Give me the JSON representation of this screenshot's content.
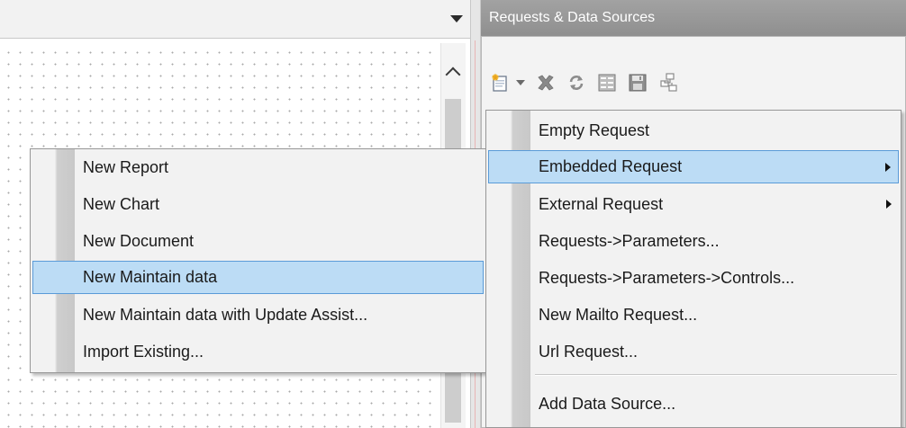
{
  "right_panel": {
    "title": "Requests & Data Sources",
    "toolbar": {
      "buttons": [
        {
          "icon": "new-request-icon"
        },
        {
          "icon": "delete-icon"
        },
        {
          "icon": "refresh-icon"
        },
        {
          "icon": "properties-icon"
        },
        {
          "icon": "save-icon"
        },
        {
          "icon": "structure-icon"
        }
      ]
    }
  },
  "left_menu": {
    "items": [
      {
        "label": "New Report"
      },
      {
        "label": "New Chart"
      },
      {
        "label": "New Document"
      },
      {
        "label": "New Maintain data",
        "highlighted": true
      },
      {
        "label": "New Maintain data with Update Assist..."
      },
      {
        "label": "Import Existing..."
      }
    ]
  },
  "right_menu": {
    "items": [
      {
        "label": "Empty Request"
      },
      {
        "label": "Embedded Request",
        "highlighted": true,
        "submenu": true
      },
      {
        "label": "External Request",
        "submenu": true
      },
      {
        "label": "Requests->Parameters..."
      },
      {
        "label": "Requests->Parameters->Controls..."
      },
      {
        "label": "New Mailto Request..."
      },
      {
        "label": "Url Request..."
      },
      {
        "label": "Add Data Source..."
      }
    ]
  },
  "colors": {
    "highlight_bg": "#bcdcf5",
    "highlight_border": "#5a9bd8",
    "panel_title_bg": "#9a9a9a"
  }
}
